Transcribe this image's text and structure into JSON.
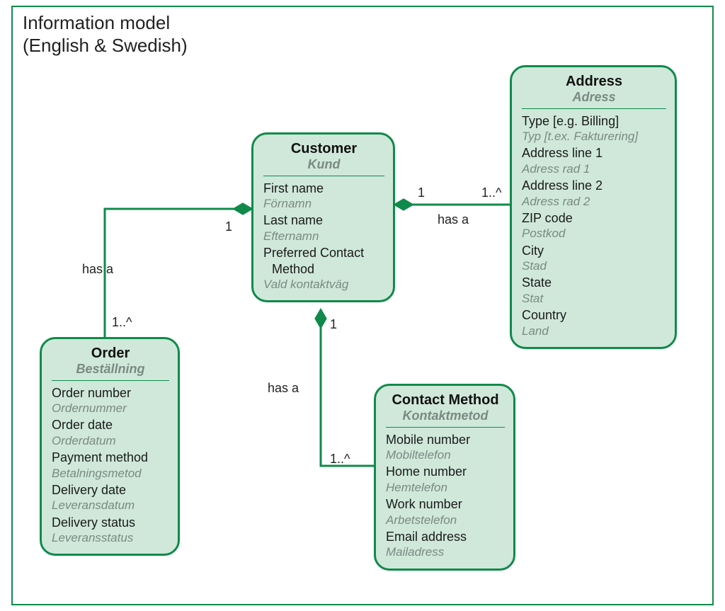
{
  "title_line1": "Information model",
  "title_line2": "(English & Swedish)",
  "colors": {
    "stroke": "#108a4b",
    "fill": "#cfe8da"
  },
  "entities": {
    "customer": {
      "name_en": "Customer",
      "name_sv": "Kund",
      "attrs": [
        {
          "en": "First name",
          "sv": "Förnamn"
        },
        {
          "en": "Last name",
          "sv": "Efternamn"
        },
        {
          "en": "Preferred Contact",
          "en2": "Method",
          "sv": "Vald kontaktväg"
        }
      ]
    },
    "address": {
      "name_en": "Address",
      "name_sv": "Adress",
      "attrs": [
        {
          "en": "Type [e.g. Billing]",
          "sv": "Typ [t.ex. Fakturering]"
        },
        {
          "en": "Address line 1",
          "sv": "Adress rad 1"
        },
        {
          "en": "Address line 2",
          "sv": "Adress rad 2"
        },
        {
          "en": "ZIP code",
          "sv": "Postkod"
        },
        {
          "en": "City",
          "sv": "Stad"
        },
        {
          "en": "State",
          "sv": "Stat"
        },
        {
          "en": "Country",
          "sv": "Land"
        }
      ]
    },
    "order": {
      "name_en": "Order",
      "name_sv": "Beställning",
      "attrs": [
        {
          "en": "Order number",
          "sv": "Ordernummer"
        },
        {
          "en": "Order date",
          "sv": "Orderdatum"
        },
        {
          "en": "Payment method",
          "sv": "Betalningsmetod"
        },
        {
          "en": "Delivery date",
          "sv": "Leveransdatum"
        },
        {
          "en": "Delivery status",
          "sv": "Leveransstatus"
        }
      ]
    },
    "contact": {
      "name_en": "Contact Method",
      "name_sv": "Kontaktmetod",
      "attrs": [
        {
          "en": "Mobile number",
          "sv": "Mobiltelefon"
        },
        {
          "en": "Home number",
          "sv": "Hemtelefon"
        },
        {
          "en": "Work number",
          "sv": "Arbetstelefon"
        },
        {
          "en": "Email address",
          "sv": "Mailadress"
        }
      ]
    }
  },
  "relations": {
    "customer_order": {
      "label": "has a",
      "near": "1",
      "far": "1..^"
    },
    "customer_address": {
      "label": "has a",
      "near": "1",
      "far": "1..^"
    },
    "customer_contact": {
      "label": "has a",
      "near": "1",
      "far": "1..^"
    }
  },
  "chart_data": {
    "type": "entity-relationship",
    "entities": [
      {
        "id": "customer",
        "name": "Customer / Kund",
        "attributes": [
          "First name / Förnamn",
          "Last name / Efternamn",
          "Preferred Contact Method / Vald kontaktväg"
        ]
      },
      {
        "id": "order",
        "name": "Order / Beställning",
        "attributes": [
          "Order number / Ordernummer",
          "Order date / Orderdatum",
          "Payment method / Betalningsmetod",
          "Delivery date / Leveransdatum",
          "Delivery status / Leveransstatus"
        ]
      },
      {
        "id": "address",
        "name": "Address / Adress",
        "attributes": [
          "Type [e.g. Billing] / Typ [t.ex. Fakturering]",
          "Address line 1 / Adress rad 1",
          "Address line 2 / Adress rad 2",
          "ZIP code / Postkod",
          "City / Stad",
          "State / Stat",
          "Country / Land"
        ]
      },
      {
        "id": "contact",
        "name": "Contact Method / Kontaktmetod",
        "attributes": [
          "Mobile number / Mobiltelefon",
          "Home number / Hemtelefon",
          "Work number / Arbetstelefon",
          "Email address / Mailadress"
        ]
      }
    ],
    "relations": [
      {
        "from": "customer",
        "to": "order",
        "label": "has a",
        "from_card": "1",
        "to_card": "1..^",
        "type": "composition"
      },
      {
        "from": "customer",
        "to": "address",
        "label": "has a",
        "from_card": "1",
        "to_card": "1..^",
        "type": "composition"
      },
      {
        "from": "customer",
        "to": "contact",
        "label": "has a",
        "from_card": "1",
        "to_card": "1..^",
        "type": "composition"
      }
    ]
  }
}
